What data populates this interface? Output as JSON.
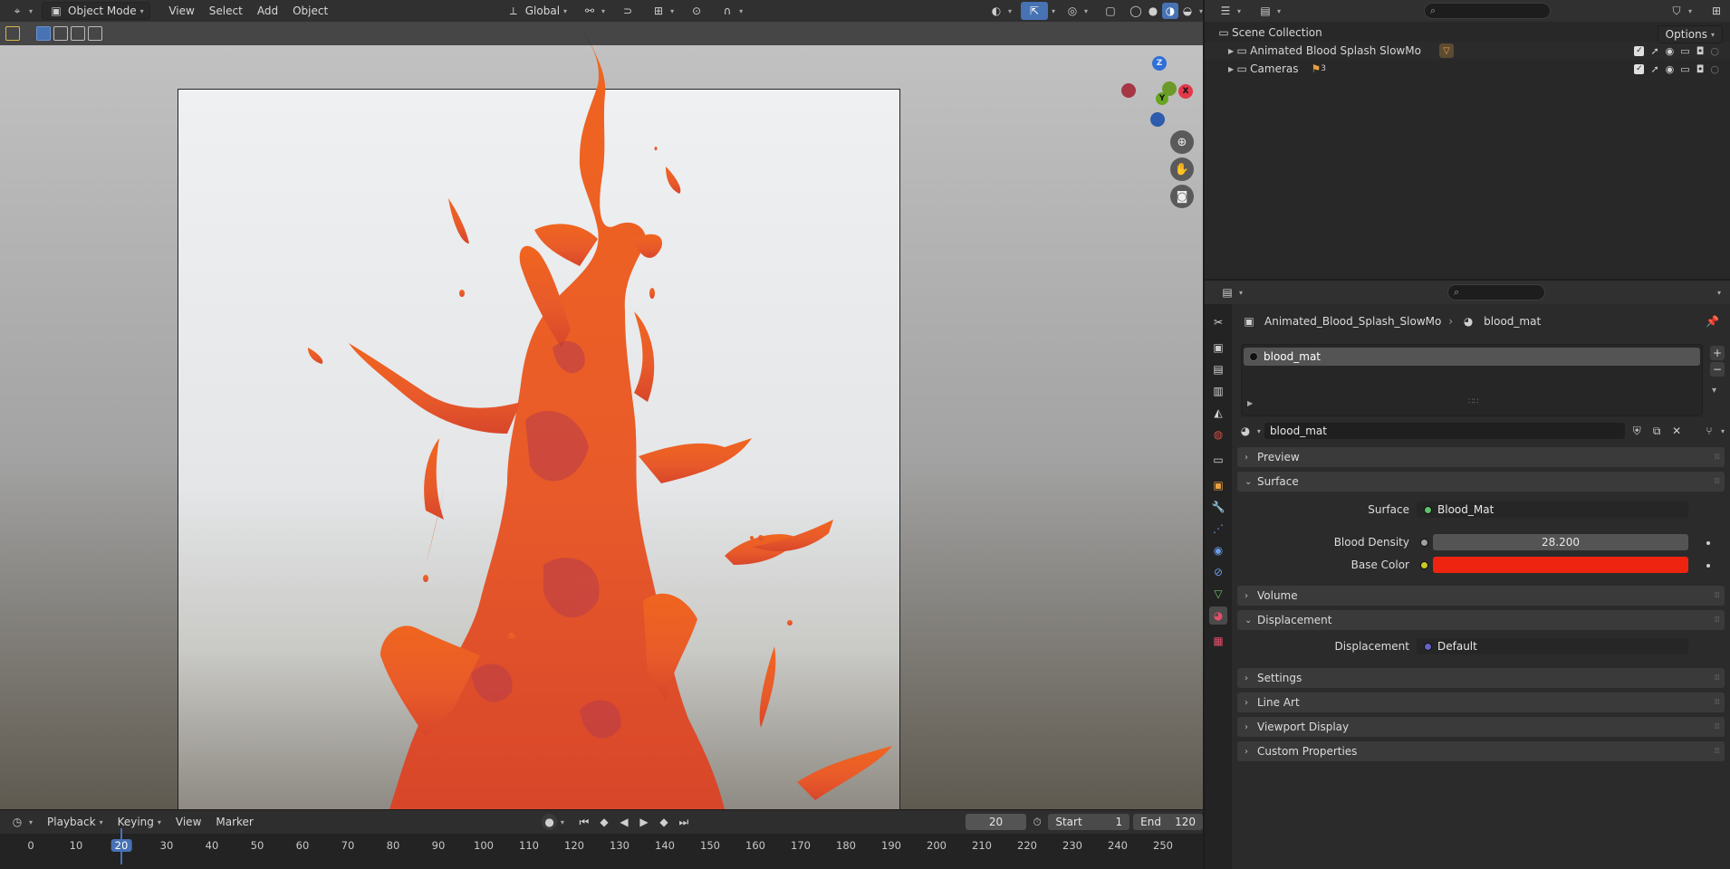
{
  "header": {
    "mode": "Object Mode",
    "menus": [
      "View",
      "Select",
      "Add",
      "Object"
    ],
    "transform_orientation": "Global",
    "options_label": "Options"
  },
  "gizmo": {
    "z": "Z",
    "y": "Y",
    "x": "X"
  },
  "outliner": {
    "root": "Scene Collection",
    "items": [
      {
        "label": "Animated Blood Splash SlowMo"
      },
      {
        "label": "Cameras",
        "badge": "3"
      }
    ]
  },
  "properties": {
    "breadcrumb_object": "Animated_Blood_Splash_SlowMo",
    "breadcrumb_material": "blood_mat",
    "slot_name": "blood_mat",
    "material_name": "blood_mat",
    "panels": {
      "preview": "Preview",
      "surface": "Surface",
      "volume": "Volume",
      "displacement": "Displacement",
      "settings": "Settings",
      "line_art": "Line Art",
      "viewport_display": "Viewport Display",
      "custom_properties": "Custom Properties"
    },
    "surface": {
      "surface_label": "Surface",
      "surface_value": "Blood_Mat",
      "density_label": "Blood Density",
      "density_value": "28.200",
      "color_label": "Base Color",
      "color": "#ee2411"
    },
    "displacement": {
      "label": "Displacement",
      "value": "Default"
    }
  },
  "timeline": {
    "menus": [
      "Playback",
      "Keying",
      "View",
      "Marker"
    ],
    "current_frame": "20",
    "start_label": "Start",
    "start": "1",
    "end_label": "End",
    "end": "120",
    "ruler": [
      "0",
      "10",
      "20",
      "30",
      "40",
      "50",
      "60",
      "70",
      "80",
      "90",
      "100",
      "110",
      "120",
      "130",
      "140",
      "150",
      "160",
      "170",
      "180",
      "190",
      "200",
      "210",
      "220",
      "230",
      "240",
      "250"
    ]
  },
  "colors": {
    "accent": "#4772b3",
    "splash": "#f0651f",
    "base_color": "#ee2411"
  }
}
